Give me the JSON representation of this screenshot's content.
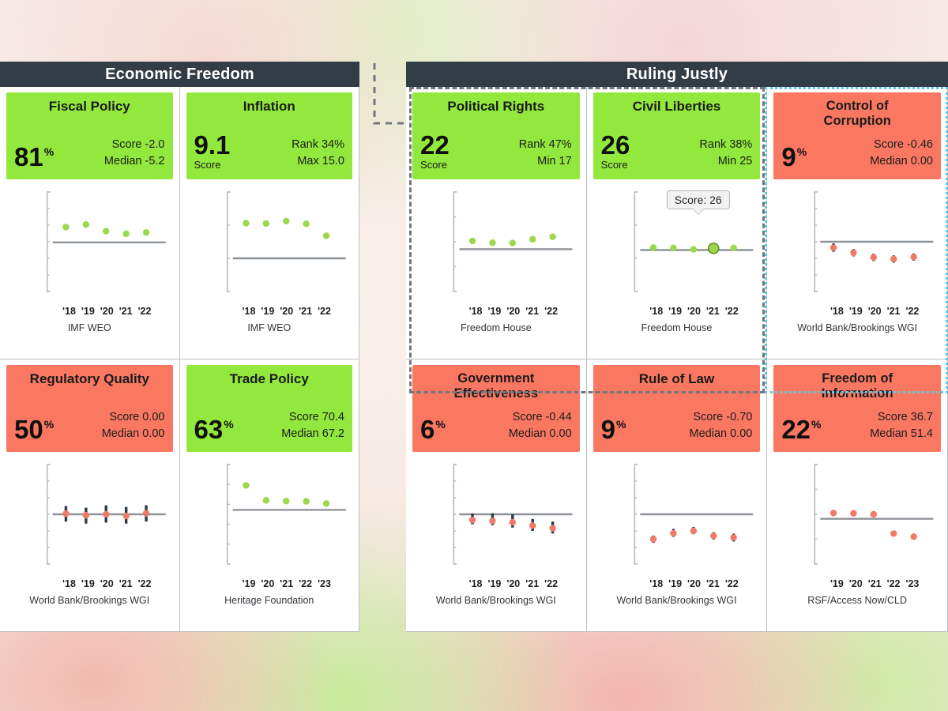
{
  "sections": [
    {
      "id": "economic-freedom",
      "title": "Economic Freedom"
    },
    {
      "id": "ruling-justly",
      "title": "Ruling Justly"
    }
  ],
  "colors": {
    "good": "#92e83c",
    "bad": "#fa7861",
    "header_bar": "#333d47",
    "dot_good": "#9bd84a",
    "dot_bad": "#ef7a66",
    "error_bar": "#2d3b4a",
    "median_line": "#8e9399",
    "selection_dashed": "#6f7781",
    "selection_dotted": "#5fc8e8"
  },
  "tooltip": {
    "text": "Score: 26",
    "card": "civil-liberties",
    "point_index": 3
  },
  "cards": [
    {
      "id": "fiscal-policy",
      "section": "economic-freedom",
      "title": "Fiscal Policy",
      "status": "good",
      "big_value": "81",
      "big_sup": "%",
      "big_sub": "",
      "stat1": "Score -2.0",
      "stat2": "Median -5.2",
      "source": "IMF WEO",
      "chart_data": {
        "type": "scatter",
        "title": "Fiscal Policy",
        "ylabel": "",
        "xlabel": "",
        "categories": [
          "'18",
          "'19",
          "'20",
          "'21",
          "'22"
        ],
        "values": [
          -0.6,
          0.2,
          -1.8,
          -2.6,
          -2.2
        ],
        "yticks": [
          10,
          5,
          0,
          -5,
          -10,
          -15,
          -20
        ],
        "ylim": [
          -20,
          10
        ],
        "median": -5.2,
        "inverted": false,
        "error_bars": false,
        "grid": false,
        "legend": "none",
        "source": "IMF WEO"
      }
    },
    {
      "id": "inflation",
      "section": "economic-freedom",
      "title": "Inflation",
      "status": "good",
      "big_value": "9.1",
      "big_sup": "",
      "big_sub": "Score",
      "stat1": "Rank 34%",
      "stat2": "Max 15.0",
      "source": "IMF WEO",
      "chart_data": {
        "type": "scatter",
        "title": "Inflation",
        "ylabel": "",
        "xlabel": "",
        "categories": [
          "'18",
          "'19",
          "'20",
          "'21",
          "'22"
        ],
        "values": [
          4.4,
          4.5,
          3.8,
          4.6,
          8.2
        ],
        "yticks": [
          -5,
          5,
          15,
          25
        ],
        "ylim": [
          -5,
          25
        ],
        "median": 15.0,
        "inverted": true,
        "error_bars": false,
        "grid": false,
        "legend": "none",
        "source": "IMF WEO"
      }
    },
    {
      "id": "regulatory-quality",
      "section": "economic-freedom",
      "title": "Regulatory Quality",
      "status": "bad",
      "big_value": "50",
      "big_sup": "%",
      "big_sub": "",
      "stat1": "Score 0.00",
      "stat2": "Median 0.00",
      "source": "World Bank/Brookings WGI",
      "chart_data": {
        "type": "scatter",
        "title": "Regulatory Quality",
        "ylabel": "",
        "xlabel": "",
        "categories": [
          "'18",
          "'19",
          "'20",
          "'21",
          "'22"
        ],
        "values": [
          0.02,
          -0.03,
          0.0,
          -0.05,
          0.03
        ],
        "err_low": [
          -0.22,
          -0.28,
          -0.25,
          -0.28,
          -0.22
        ],
        "err_high": [
          0.25,
          0.2,
          0.27,
          0.22,
          0.27
        ],
        "yticks": [
          1.5,
          1.0,
          0.5,
          0.0,
          -0.5,
          -1.0,
          -1.5
        ],
        "ylim": [
          -1.5,
          1.5
        ],
        "median": 0.0,
        "inverted": false,
        "error_bars": true,
        "grid": false,
        "legend": "none",
        "source": "World Bank/Brookings WGI"
      }
    },
    {
      "id": "trade-policy",
      "section": "economic-freedom",
      "title": "Trade Policy",
      "status": "good",
      "big_value": "63",
      "big_sup": "%",
      "big_sub": "",
      "stat1": "Score 70.4",
      "stat2": "Median 67.2",
      "source": "Heritage Foundation",
      "chart_data": {
        "type": "scatter",
        "title": "Trade Policy",
        "ylabel": "",
        "xlabel": "",
        "categories": [
          "'19",
          "'20",
          "'21",
          "'22",
          "'23"
        ],
        "values": [
          79.5,
          72.0,
          71.6,
          71.5,
          70.4
        ],
        "yticks": [
          90,
          80,
          70,
          60,
          50,
          40
        ],
        "ylim": [
          40,
          90
        ],
        "median": 67.2,
        "inverted": false,
        "error_bars": false,
        "grid": false,
        "legend": "none",
        "source": "Heritage Foundation"
      }
    },
    {
      "id": "political-rights",
      "section": "ruling-justly",
      "title": "Political Rights",
      "status": "good",
      "big_value": "22",
      "big_sup": "",
      "big_sub": "Score",
      "stat1": "Rank 47%",
      "stat2": "Min 17",
      "source": "Freedom House",
      "selected": "dashed",
      "chart_data": {
        "type": "scatter",
        "title": "Political Rights",
        "ylabel": "",
        "xlabel": "",
        "categories": [
          "'18",
          "'19",
          "'20",
          "'21",
          "'22"
        ],
        "values": [
          20.3,
          19.6,
          19.5,
          21.0,
          22.0
        ],
        "yticks": [
          40,
          30,
          20,
          10,
          0
        ],
        "ylim": [
          0,
          40
        ],
        "median": 17,
        "inverted": false,
        "error_bars": false,
        "grid": false,
        "legend": "none",
        "source": "Freedom House"
      }
    },
    {
      "id": "civil-liberties",
      "section": "ruling-justly",
      "title": "Civil Liberties",
      "status": "good",
      "big_value": "26",
      "big_sup": "",
      "big_sub": "Score",
      "stat1": "Rank 38%",
      "stat2": "Min 25",
      "source": "Freedom House",
      "selected": "dashed",
      "chart_data": {
        "type": "scatter",
        "title": "Civil Liberties",
        "ylabel": "",
        "xlabel": "",
        "categories": [
          "'18",
          "'19",
          "'20",
          "'21",
          "'22"
        ],
        "values": [
          26.5,
          26.3,
          25.4,
          26.0,
          26.3
        ],
        "yticks": [
          60,
          40,
          20,
          0
        ],
        "ylim": [
          0,
          60
        ],
        "median": 25,
        "inverted": false,
        "error_bars": false,
        "highlight_index": 3,
        "grid": false,
        "legend": "none",
        "source": "Freedom House"
      }
    },
    {
      "id": "control-of-corruption",
      "section": "ruling-justly",
      "title": "Control of Corruption",
      "title_lines": [
        "Control of",
        "Corruption"
      ],
      "status": "bad",
      "big_value": "9",
      "big_sup": "%",
      "big_sub": "",
      "stat1": "Score -0.46",
      "stat2": "Median 0.00",
      "source": "World Bank/Brookings WGI",
      "selected": "dotted",
      "chart_data": {
        "type": "scatter",
        "title": "Control of Corruption",
        "ylabel": "",
        "xlabel": "",
        "categories": [
          "'18",
          "'19",
          "'20",
          "'21",
          "'22"
        ],
        "values": [
          -0.18,
          -0.33,
          -0.47,
          -0.52,
          -0.46
        ],
        "err_low": [
          -0.3,
          -0.44,
          -0.58,
          -0.63,
          -0.57
        ],
        "err_high": [
          -0.05,
          -0.22,
          -0.36,
          -0.41,
          -0.35
        ],
        "yticks": [
          1.5,
          1.0,
          0.5,
          0.0,
          -0.5,
          -1.0,
          -1.5
        ],
        "ylim": [
          -1.5,
          1.5
        ],
        "median": 0.0,
        "inverted": false,
        "error_bars": true,
        "grid": false,
        "legend": "none",
        "source": "World Bank/Brookings WGI"
      }
    },
    {
      "id": "government-effectiveness",
      "section": "ruling-justly",
      "title": "Government Effectiveness",
      "title_lines": [
        "Government",
        "Effectiveness"
      ],
      "status": "bad",
      "big_value": "6",
      "big_sup": "%",
      "big_sub": "",
      "stat1": "Score -0.44",
      "stat2": "Median 0.00",
      "source": "World Bank/Brookings WGI",
      "chart_data": {
        "type": "scatter",
        "title": "Government Effectiveness",
        "ylabel": "",
        "xlabel": "",
        "categories": [
          "'18",
          "'19",
          "'20",
          "'21",
          "'22"
        ],
        "values": [
          -0.17,
          -0.2,
          -0.24,
          -0.34,
          -0.42
        ],
        "err_low": [
          -0.3,
          -0.33,
          -0.4,
          -0.5,
          -0.58
        ],
        "err_high": [
          0.02,
          0.03,
          0.0,
          -0.14,
          -0.22
        ],
        "yticks": [
          1.5,
          1.0,
          0.5,
          0.0,
          -0.5,
          -1.0,
          -1.5
        ],
        "ylim": [
          -1.5,
          1.5
        ],
        "median": 0.0,
        "inverted": false,
        "error_bars": true,
        "grid": false,
        "legend": "none",
        "source": "World Bank/Brookings WGI"
      }
    },
    {
      "id": "rule-of-law",
      "section": "ruling-justly",
      "title": "Rule of Law",
      "status": "bad",
      "big_value": "9",
      "big_sup": "%",
      "big_sub": "",
      "stat1": "Score -0.70",
      "stat2": "Median 0.00",
      "source": "World Bank/Brookings WGI",
      "chart_data": {
        "type": "scatter",
        "title": "Rule of Law",
        "ylabel": "",
        "xlabel": "",
        "categories": [
          "'18",
          "'19",
          "'20",
          "'21",
          "'22"
        ],
        "values": [
          -0.75,
          -0.57,
          -0.5,
          -0.65,
          -0.7
        ],
        "err_low": [
          -0.86,
          -0.68,
          -0.6,
          -0.76,
          -0.82
        ],
        "err_high": [
          -0.64,
          -0.44,
          -0.38,
          -0.54,
          -0.58
        ],
        "yticks": [
          1.5,
          1.0,
          0.5,
          0.0,
          -0.5,
          -1.0,
          -1.5
        ],
        "ylim": [
          -1.5,
          1.5
        ],
        "median": 0.0,
        "inverted": false,
        "error_bars": true,
        "grid": false,
        "legend": "none",
        "source": "World Bank/Brookings WGI"
      }
    },
    {
      "id": "freedom-of-information",
      "section": "ruling-justly",
      "title": "Freedom of Information",
      "title_lines": [
        "Freedom of",
        "Information"
      ],
      "status": "bad",
      "big_value": "22",
      "big_sup": "%",
      "big_sub": "",
      "stat1": "Score 36.7",
      "stat2": "Median 51.4",
      "source": "RSF/Access Now/CLD",
      "chart_data": {
        "type": "scatter",
        "title": "Freedom of Information",
        "ylabel": "",
        "xlabel": "",
        "categories": [
          "'19",
          "'20",
          "'21",
          "'22",
          "'23"
        ],
        "values": [
          56.0,
          55.8,
          55.0,
          39.5,
          37.0
        ],
        "yticks": [
          95,
          75,
          55,
          35,
          15
        ],
        "ylim": [
          15,
          95
        ],
        "median": 51.4,
        "inverted": false,
        "error_bars": false,
        "grid": false,
        "legend": "none",
        "source": "RSF/Access Now/CLD"
      }
    }
  ]
}
